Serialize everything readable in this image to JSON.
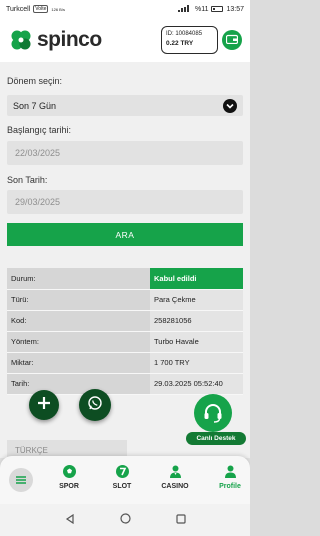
{
  "status_bar": {
    "carrier": "Turkcell",
    "network_badge": "Volte",
    "net_rate": "126 B/s",
    "battery": "%11",
    "time": "13:57"
  },
  "header": {
    "brand": "spinco",
    "account_id": "ID: 10084085",
    "balance": "0.22 TRY"
  },
  "filter": {
    "period_label": "Dönem seçin:",
    "period_value": "Son 7 Gün",
    "start_label": "Başlangıç tarihi:",
    "start_placeholder": "22/03/2025",
    "end_label": "Son Tarih:",
    "end_placeholder": "29/03/2025",
    "search_button": "ARA"
  },
  "details": [
    {
      "key": "Durum:",
      "value": "Kabul edildi"
    },
    {
      "key": "Türü:",
      "value": "Para Çekme"
    },
    {
      "key": "Kod:",
      "value": "258281056"
    },
    {
      "key": "Yöntem:",
      "value": "Turbo Havale"
    },
    {
      "key": "Miktar:",
      "value": "1 700 TRY"
    },
    {
      "key": "Tarih:",
      "value": "29.03.2025 05:52:40"
    }
  ],
  "language": "TÜRKÇE",
  "support_label": "Canlı Destek",
  "bottom_nav": {
    "spor": "SPOR",
    "slot": "SLOT",
    "casino": "CASINO",
    "profile": "Profile"
  },
  "colors": {
    "accent": "#16a34a",
    "dark_green": "#0d4d22"
  },
  "icons": [
    "clover-logo-icon",
    "wallet-icon",
    "chevron-down-icon",
    "plus-icon",
    "whatsapp-icon",
    "headset-icon",
    "menu-icon",
    "soccer-ball-icon",
    "slot-seven-icon",
    "casino-dealer-icon",
    "profile-user-icon"
  ]
}
